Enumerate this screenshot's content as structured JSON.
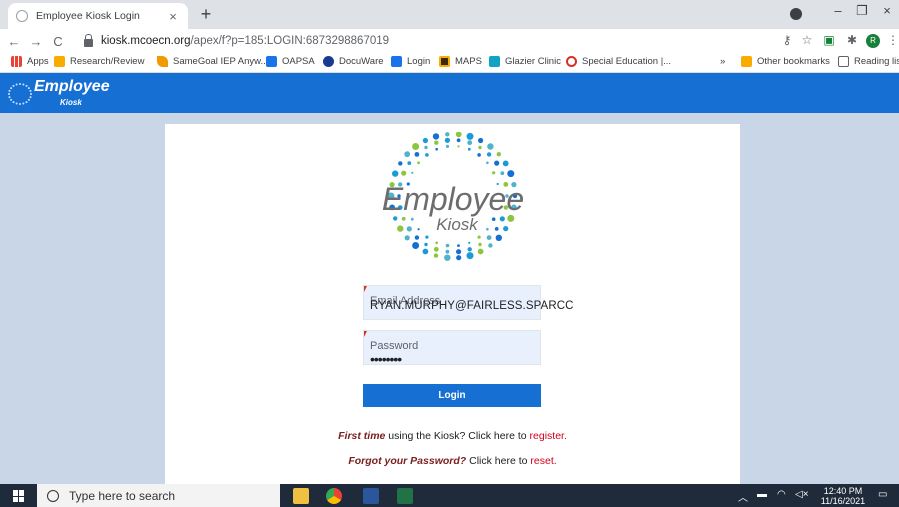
{
  "browser": {
    "tab_title": "Employee Kiosk Login",
    "tab_close": "×",
    "new_tab": "+",
    "url_host": "kiosk.mcoecn.org",
    "url_path": "/apex/f?p=185:LOGIN:6873298867019",
    "avatar_letter": "R",
    "window_controls": {
      "minimize": "–",
      "restore": "❐",
      "close": "×"
    }
  },
  "bookmarks": {
    "items": [
      {
        "label": "Apps",
        "icon": "apps-grid-icon",
        "color": "#ea4335"
      },
      {
        "label": "Research/Review",
        "icon": "folder-icon",
        "color": "#f9ab00"
      },
      {
        "label": "SameGoal IEP Anyw...",
        "icon": "samegoal-icon",
        "color": "#f29900"
      },
      {
        "label": "OAPSA",
        "icon": "oapsa-icon",
        "color": "#1a73e8"
      },
      {
        "label": "DocuWare",
        "icon": "docuware-icon",
        "color": "#1a3a8f"
      },
      {
        "label": "Login",
        "icon": "login-icon",
        "color": "#1a73e8"
      },
      {
        "label": "MAPS",
        "icon": "maps-icon",
        "color": "#f9ab00"
      },
      {
        "label": "Glazier Clinic",
        "icon": "glazier-icon",
        "color": "#12a3c4"
      },
      {
        "label": "Special Education |...",
        "icon": "special-ed-icon",
        "color": "#d93025"
      }
    ],
    "overflow": "»",
    "other_bookmarks": "Other bookmarks",
    "reading_list": "Reading list"
  },
  "app_header": {
    "title": "Employee",
    "subtitle": "Kiosk",
    "color": "#1670d4"
  },
  "login": {
    "logo_word": "Employee",
    "logo_sub": "Kiosk",
    "email_placeholder": "Email Address",
    "email_value": "RYAN.MURPHY@FAIRLESS.SPARCC",
    "password_placeholder": "Password",
    "password_dots": "••••••••",
    "login_button": "Login",
    "first_time_bold": "First time",
    "first_time_text": " using the Kiosk? Click here to ",
    "register_link": "register.",
    "forgot_bold": "Forgot your Password?",
    "forgot_text": " Click here to ",
    "reset_link": "reset."
  },
  "taskbar": {
    "search_placeholder": "Type here to search",
    "time": "12:40 PM",
    "date": "11/16/2021"
  }
}
